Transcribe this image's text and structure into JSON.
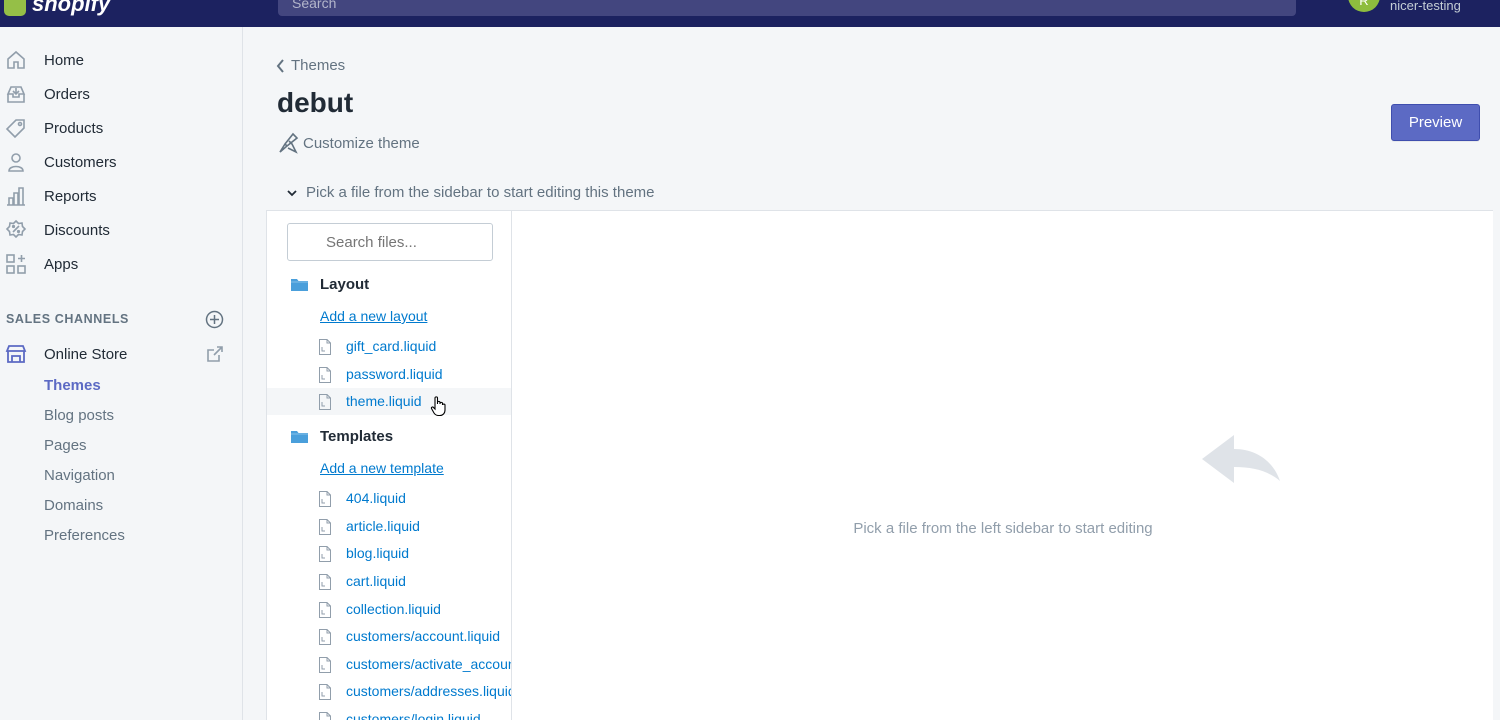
{
  "topbar": {
    "brand": "shopify",
    "search_placeholder": "Search",
    "user_initials": "R",
    "user_name": "nicer-testing"
  },
  "sidebar": {
    "items": [
      {
        "label": "Home",
        "icon": "home-icon"
      },
      {
        "label": "Orders",
        "icon": "orders-icon"
      },
      {
        "label": "Products",
        "icon": "tag-icon"
      },
      {
        "label": "Customers",
        "icon": "person-icon"
      },
      {
        "label": "Reports",
        "icon": "bar-chart-icon"
      },
      {
        "label": "Discounts",
        "icon": "discount-icon"
      },
      {
        "label": "Apps",
        "icon": "apps-icon"
      }
    ],
    "sales_channels_heading": "SALES CHANNELS",
    "online_store": "Online Store",
    "sub_items": [
      "Themes",
      "Blog posts",
      "Pages",
      "Navigation",
      "Domains",
      "Preferences"
    ]
  },
  "main": {
    "breadcrumb": "Themes",
    "title": "debut",
    "customize": "Customize theme",
    "preview_button": "Preview",
    "hint": "Pick a file from the sidebar to start editing this theme",
    "search_placeholder": "Search files...",
    "layout": {
      "heading": "Layout",
      "add_link": "Add a new layout",
      "files": [
        "gift_card.liquid",
        "password.liquid",
        "theme.liquid"
      ]
    },
    "templates": {
      "heading": "Templates",
      "add_link": "Add a new template",
      "files": [
        "404.liquid",
        "article.liquid",
        "blog.liquid",
        "cart.liquid",
        "collection.liquid",
        "customers/account.liquid",
        "customers/activate_account.liquid",
        "customers/addresses.liquid",
        "customers/login.liquid"
      ]
    },
    "empty_text": "Pick a file from the left sidebar to start editing"
  },
  "colors": {
    "topbar": "#1c2260",
    "accent": "#5c6ac4",
    "link": "#007ace",
    "folder": "#4a9fdb"
  }
}
